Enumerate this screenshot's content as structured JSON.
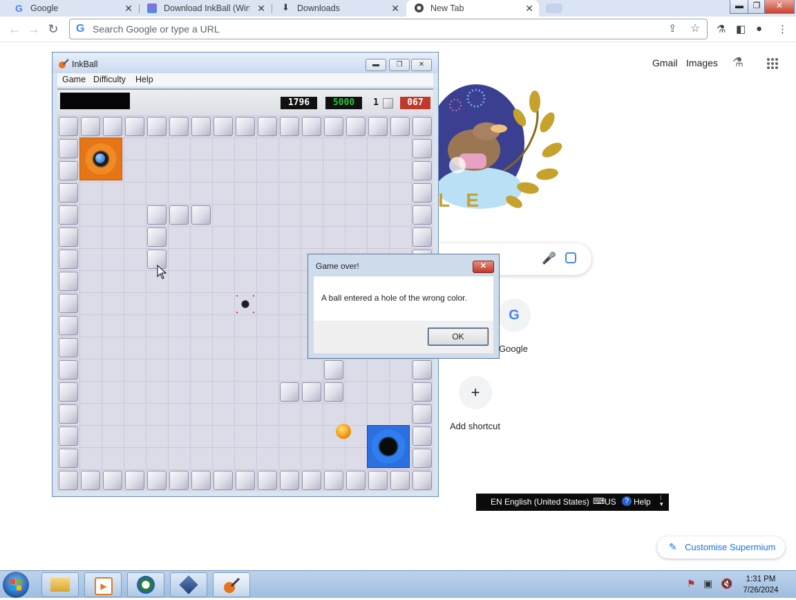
{
  "browser": {
    "tabs": [
      {
        "title": "Google",
        "icon": "google-g-icon"
      },
      {
        "title": "Download InkBall (Win",
        "icon": "inkball-download-icon"
      },
      {
        "title": "Downloads",
        "icon": "download-arrow-icon"
      },
      {
        "title": "New Tab",
        "icon": "chrome-icon",
        "active": true
      }
    ],
    "close_glyph": "✕",
    "window_controls": {
      "minimize": "▬",
      "restore": "❐",
      "close": "✕"
    },
    "omnibox_placeholder": "Search Google or type a URL"
  },
  "new_tab_page": {
    "top_links": [
      "Gmail",
      "Images"
    ],
    "doodle_letters": "L E",
    "shortcuts": [
      {
        "label": "Google",
        "icon_text": "G"
      },
      {
        "label": "Add shortcut",
        "icon_text": "+"
      }
    ],
    "customise_label": "Customise Supermium"
  },
  "language_bar": {
    "language": "EN English (United States)",
    "keyboard": "US",
    "help": "Help"
  },
  "inkball": {
    "title": "InkBall",
    "menu": [
      "Game",
      "Difficulty",
      "Help"
    ],
    "scores": {
      "current": "1796",
      "target": "5000",
      "lives": "1",
      "timer": "067"
    }
  },
  "dialog": {
    "title": "Game over!",
    "message": "A ball entered a hole of the wrong color.",
    "ok_label": "OK",
    "close_glyph": "✕"
  },
  "taskbar": {
    "time": "1:31 PM",
    "date": "7/26/2024"
  },
  "colors": {
    "orange_hole": "#f08a24",
    "blue_hole": "#2f7ff0",
    "score_green": "#2bc23a",
    "timer_red": "#c0392b"
  }
}
